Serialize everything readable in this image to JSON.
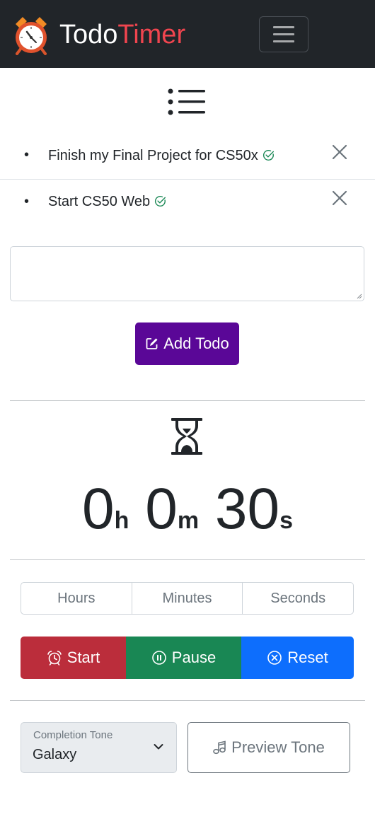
{
  "navbar": {
    "brand_part1": "Todo",
    "brand_part2": "Timer",
    "brand_icon": "alarm-clock-icon",
    "menu_icon": "hamburger-icon"
  },
  "todos": {
    "list_icon": "list-icon",
    "items": [
      {
        "text": "Finish my Final Project for CS50x",
        "bullet": "•"
      },
      {
        "text": "Start CS50 Web",
        "bullet": "•"
      }
    ],
    "input_value": "",
    "add_label": "Add Todo"
  },
  "timer": {
    "icon": "hourglass-icon",
    "hours": "0",
    "hours_unit": "h",
    "minutes": "0",
    "minutes_unit": "m",
    "seconds": "30",
    "seconds_unit": "s",
    "fields": {
      "hours_placeholder": "Hours",
      "minutes_placeholder": "Minutes",
      "seconds_placeholder": "Seconds"
    },
    "start_label": "Start",
    "pause_label": "Pause",
    "reset_label": "Reset"
  },
  "tone": {
    "select_label": "Completion Tone",
    "selected": "Galaxy",
    "preview_label": "Preview Tone"
  },
  "colors": {
    "navbar_bg": "#212529",
    "brand_accent": "#f0454f",
    "add_button": "#5a0797",
    "start": "#bb2d3b",
    "pause": "#198754",
    "reset": "#0d6efd",
    "check": "#198754"
  }
}
